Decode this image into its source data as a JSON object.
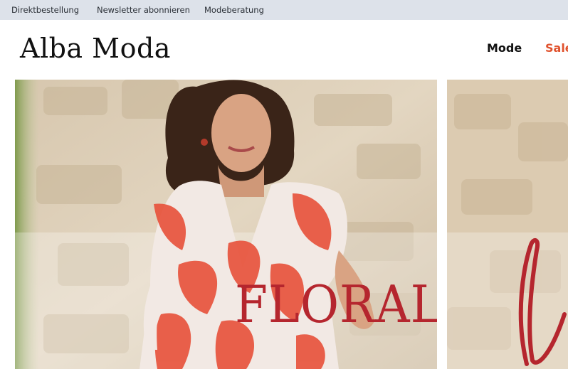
{
  "topbar": {
    "links": [
      "Direktbestellung",
      "Newsletter abonnieren",
      "Modeberatung"
    ]
  },
  "header": {
    "logo": "Alba Moda",
    "nav": [
      "Mode",
      "Sale"
    ]
  },
  "hero": {
    "headline": "FLORALE",
    "script_letter": "l"
  },
  "colors": {
    "topbar_bg": "#dde2ea",
    "sale_accent": "#e0522d",
    "headline_red": "#b5262e"
  }
}
